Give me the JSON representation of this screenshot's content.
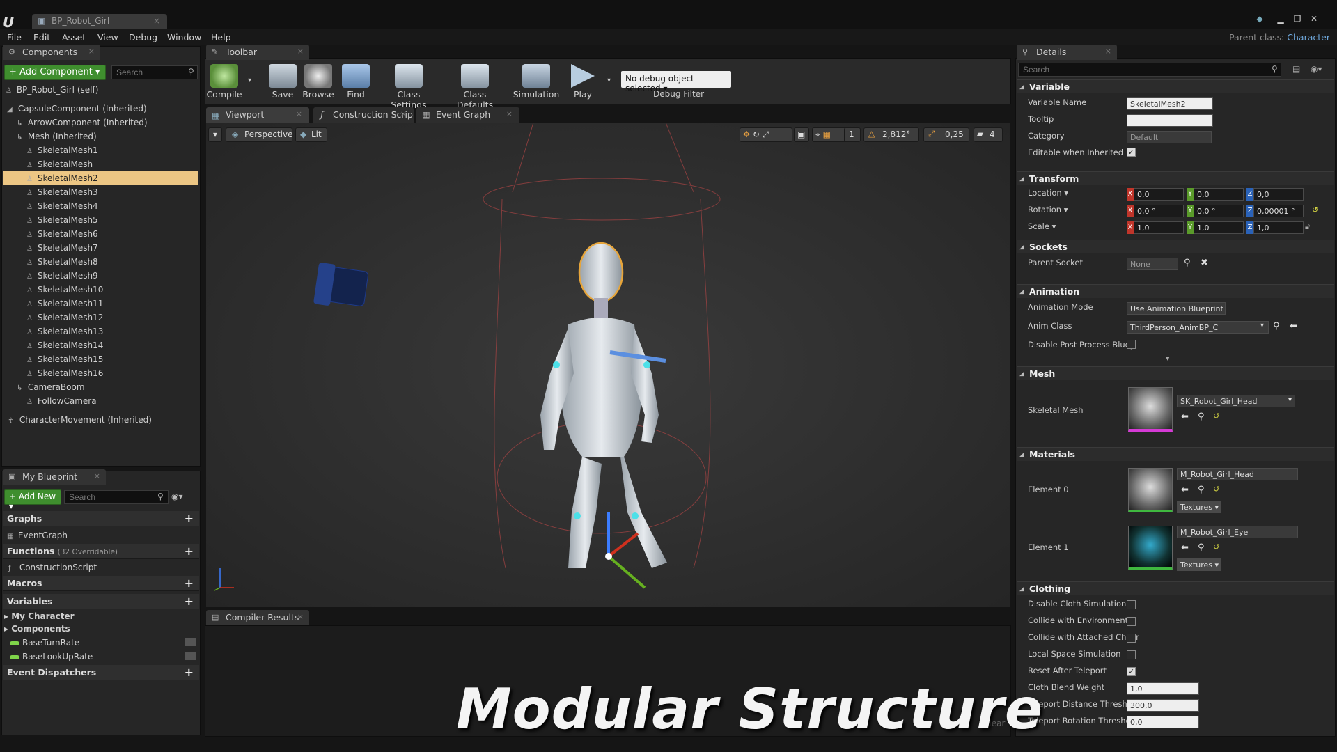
{
  "window": {
    "doc_tab": "BP_Robot_Girl",
    "parent_class_label": "Parent class:",
    "parent_class_value": "Character"
  },
  "menu": [
    "File",
    "Edit",
    "Asset",
    "View",
    "Debug",
    "Window",
    "Help"
  ],
  "components": {
    "tab": "Components",
    "add_button": "+ Add Component ▾",
    "search_placeholder": "Search",
    "self": "BP_Robot_Girl (self)",
    "items": [
      {
        "label": "CapsuleComponent (Inherited)",
        "indent": 0
      },
      {
        "label": "ArrowComponent (Inherited)",
        "indent": 1
      },
      {
        "label": "Mesh (Inherited)",
        "indent": 1
      },
      {
        "label": "SkeletalMesh1",
        "indent": 2
      },
      {
        "label": "SkeletalMesh",
        "indent": 2
      },
      {
        "label": "SkeletalMesh2",
        "indent": 2,
        "selected": true
      },
      {
        "label": "SkeletalMesh3",
        "indent": 2
      },
      {
        "label": "SkeletalMesh4",
        "indent": 2
      },
      {
        "label": "SkeletalMesh5",
        "indent": 2
      },
      {
        "label": "SkeletalMesh6",
        "indent": 2
      },
      {
        "label": "SkeletalMesh7",
        "indent": 2
      },
      {
        "label": "SkeletalMesh8",
        "indent": 2
      },
      {
        "label": "SkeletalMesh9",
        "indent": 2
      },
      {
        "label": "SkeletalMesh10",
        "indent": 2
      },
      {
        "label": "SkeletalMesh11",
        "indent": 2
      },
      {
        "label": "SkeletalMesh12",
        "indent": 2
      },
      {
        "label": "SkeletalMesh13",
        "indent": 2
      },
      {
        "label": "SkeletalMesh14",
        "indent": 2
      },
      {
        "label": "SkeletalMesh15",
        "indent": 2
      },
      {
        "label": "SkeletalMesh16",
        "indent": 2
      },
      {
        "label": "CameraBoom",
        "indent": 1
      },
      {
        "label": "FollowCamera",
        "indent": 2
      }
    ],
    "movement": "CharacterMovement (Inherited)"
  },
  "blueprint": {
    "tab": "My Blueprint",
    "add_new": "+ Add New ▾",
    "search_placeholder": "Search",
    "graphs": "Graphs",
    "event_graph": "EventGraph",
    "functions": "Functions",
    "functions_note": "(32 Overridable)",
    "construction": "ConstructionScript",
    "macros": "Macros",
    "variables": "Variables",
    "my_character": "My Character",
    "components": "Components",
    "vars": [
      "BaseTurnRate",
      "BaseLookUpRate"
    ],
    "dispatchers": "Event Dispatchers"
  },
  "toolbar": {
    "tab": "Toolbar",
    "buttons": [
      "Compile",
      "Save",
      "Browse",
      "Find",
      "Class Settings",
      "Class Defaults",
      "Simulation",
      "Play"
    ],
    "debug_select": "No debug object selected ▾",
    "debug_filter": "Debug Filter"
  },
  "editor_tabs": [
    "Viewport",
    "Construction Scrip",
    "Event Graph"
  ],
  "viewport": {
    "perspective": "Perspective",
    "lit": "Lit",
    "grid": "1",
    "angle": "2,812°",
    "scale": "0,25",
    "speed": "4"
  },
  "compiler": {
    "tab": "Compiler Results",
    "clear": "Clear"
  },
  "overlay_title": "Modular Structure",
  "details": {
    "tab": "Details",
    "search_placeholder": "Search",
    "variable": {
      "title": "Variable",
      "name_label": "Variable Name",
      "name_value": "SkeletalMesh2",
      "tooltip_label": "Tooltip",
      "category_label": "Category",
      "category_value": "Default",
      "editable_label": "Editable when Inherited"
    },
    "transform": {
      "title": "Transform",
      "location": "Location ▾",
      "rotation": "Rotation ▾",
      "scale": "Scale ▾",
      "loc": [
        "0,0",
        "0,0",
        "0,0"
      ],
      "rot": [
        "0,0 °",
        "0,0 °",
        "0,00001 °"
      ],
      "scl": [
        "1,0",
        "1,0",
        "1,0"
      ]
    },
    "sockets": {
      "title": "Sockets",
      "parent_label": "Parent Socket",
      "parent_value": "None"
    },
    "animation": {
      "title": "Animation",
      "mode_label": "Animation Mode",
      "mode_value": "Use Animation Blueprint ▾",
      "class_label": "Anim Class",
      "class_value": "ThirdPerson_AnimBP_C",
      "disable_label": "Disable Post Process Bluep"
    },
    "mesh": {
      "title": "Mesh",
      "label": "Skeletal Mesh",
      "value": "SK_Robot_Girl_Head"
    },
    "materials": {
      "title": "Materials",
      "e0": "Element 0",
      "e0_value": "M_Robot_Girl_Head",
      "e1": "Element 1",
      "e1_value": "M_Robot_Girl_Eye",
      "textures": "Textures ▾"
    },
    "clothing": {
      "title": "Clothing",
      "items": [
        "Disable Cloth Simulation",
        "Collide with Environment",
        "Collide with Attached Childr",
        "Local Space Simulation",
        "Reset After Teleport",
        "Cloth Blend Weight",
        "Teleport Distance Threshol",
        "Teleport Rotation Threshol"
      ],
      "blend": "1,0",
      "dist": "300,0",
      "rot": "0,0"
    }
  }
}
